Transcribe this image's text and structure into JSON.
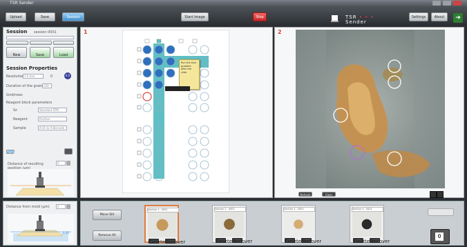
{
  "window": {
    "title": "TSR Sender"
  },
  "toolbar": {
    "buttons": [
      {
        "label": "Upload",
        "active": false
      },
      {
        "label": "Save",
        "active": false
      },
      {
        "label": "Session",
        "active": true
      }
    ],
    "start_image": "Start Image",
    "stop": "Stop",
    "logo": "TSR",
    "logo_dots": "• • •",
    "logo_sub": "Sender",
    "settings": "Settings",
    "about": "About",
    "exit_icon": "exit-icon"
  },
  "session": {
    "title": "Session",
    "name": "session 0001",
    "icon_labels": [
      "New",
      "Save",
      "Load"
    ]
  },
  "properties": {
    "title": "Session Properties",
    "rows": [
      {
        "label": "Resolution",
        "value": "1.0 mm",
        "unit": "0",
        "badge": "0.0"
      },
      {
        "label": "Duration of the grains",
        "value": "120"
      },
      {
        "label": "Grid/rows",
        "value": ""
      }
    ],
    "subtitle": "Reagent block parameters",
    "params": [
      {
        "label": "Sz",
        "value": "Standard RTM"
      },
      {
        "label": "Reagent",
        "value": "Positive"
      },
      {
        "label": "Sample",
        "value": "A-01 to A-Barcode"
      }
    ],
    "apply": "Apply",
    "distance_label": "Distance of resulting position (µm)",
    "distance_value": "0"
  },
  "view1": {
    "number": "1",
    "tooltip": "Run the blue gradient after the slide"
  },
  "view2": {
    "number": "2",
    "controls": [
      "Refresh",
      "Clear"
    ]
  },
  "bottom_left": {
    "label": "Distance from mold (µm)",
    "value": "0",
    "marker": "0.00"
  },
  "bottom": {
    "left_buttons": [
      "Move Slit",
      "Remove All"
    ],
    "thumbs": [
      {
        "label": "Section 1 - 0001",
        "buttons": [
          "Delete",
          "Recover"
        ]
      },
      {
        "label": "Section 2 - 0001",
        "buttons": [
          "Delete",
          "Recover"
        ]
      },
      {
        "label": "Section 3 - 0001",
        "buttons": [
          "Delete",
          "Recover"
        ]
      },
      {
        "label": "Section 4 - 0001",
        "buttons": [
          "Delete",
          "Recover"
        ]
      }
    ],
    "counter": "0"
  },
  "colors": {
    "accent": "#3f8fd0",
    "teal": "#5fbfc4",
    "marker_red": "#d8432f",
    "well_blue": "#2f6fbf"
  }
}
